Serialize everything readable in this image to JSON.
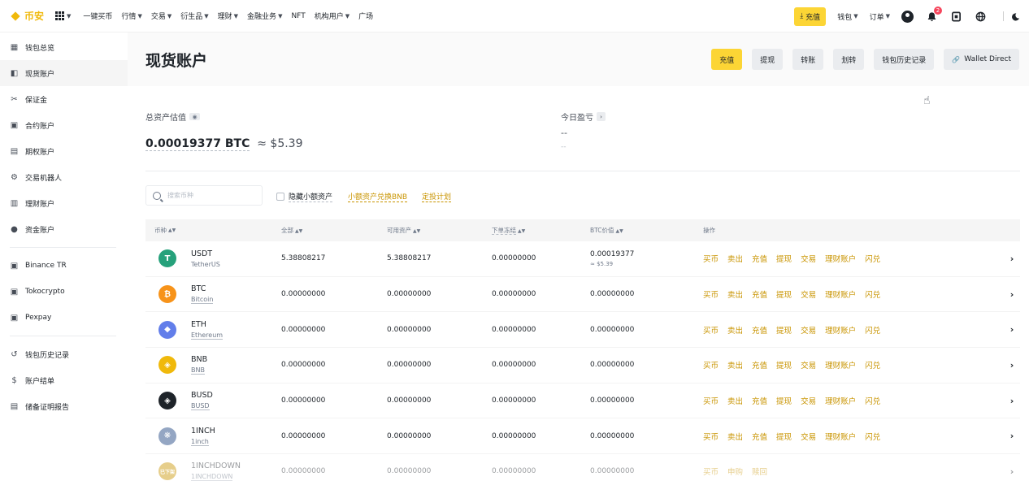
{
  "topbar": {
    "logo": "币安",
    "nav": [
      "一键买币",
      "行情",
      "交易",
      "衍生品",
      "理财",
      "金融业务",
      "NFT",
      "机构用户",
      "广场"
    ],
    "nav_dropdown": [
      false,
      true,
      true,
      true,
      true,
      true,
      false,
      true,
      false
    ],
    "deposit": "充值",
    "wallet": "钱包",
    "orders": "订单",
    "notif_count": "2"
  },
  "sidebar": {
    "items": [
      {
        "label": "钱包总览",
        "icon": "dashboard-icon"
      },
      {
        "label": "现货账户",
        "icon": "spot-icon",
        "active": true
      },
      {
        "label": "保证金",
        "icon": "margin-icon"
      },
      {
        "label": "合约账户",
        "icon": "futures-icon"
      },
      {
        "label": "期权账户",
        "icon": "options-icon"
      },
      {
        "label": "交易机器人",
        "icon": "bot-icon"
      },
      {
        "label": "理财账户",
        "icon": "earn-icon"
      },
      {
        "label": "资金账户",
        "icon": "funding-icon"
      }
    ],
    "external": [
      {
        "label": "Binance TR"
      },
      {
        "label": "Tokocrypto"
      },
      {
        "label": "Pexpay"
      }
    ],
    "bottom": [
      {
        "label": "钱包历史记录"
      },
      {
        "label": "账户结单"
      },
      {
        "label": "储备证明报告"
      }
    ]
  },
  "main": {
    "title": "现货账户",
    "actions": [
      "充值",
      "提现",
      "转账",
      "划转",
      "钱包历史记录",
      "Wallet Direct"
    ],
    "estimate_label": "总资产估值",
    "estimate_btc": "0.00019377 BTC",
    "estimate_fiat": "≈ $5.39",
    "pnl_label": "今日盈亏",
    "pnl_value": "--",
    "pnl_sub": "--",
    "search_placeholder": "搜索币种",
    "hide_small": "隐藏小额资产",
    "convert_bnb": "小额资产兑换BNB",
    "invest_plan": "定投计划"
  },
  "table": {
    "headers": {
      "coin": "币种",
      "total": "全部",
      "available": "可用资产",
      "in_order": "下单冻结",
      "btc_value": "BTC价值",
      "ops": "操作"
    },
    "rows": [
      {
        "sym": "USDT",
        "name": "TetherUS",
        "total": "5.38808217",
        "available": "5.38808217",
        "in_order": "0.00000000",
        "btc": "0.00019377",
        "btc_sub": "≈ $5.39",
        "color": "#26a17b",
        "glyph": "T",
        "ops": [
          "买币",
          "卖出",
          "充值",
          "提现",
          "交易",
          "理财账户",
          "闪兑"
        ]
      },
      {
        "sym": "BTC",
        "name": "Bitcoin",
        "total": "0.00000000",
        "available": "0.00000000",
        "in_order": "0.00000000",
        "btc": "0.00000000",
        "color": "#f7931a",
        "glyph": "₿",
        "ops": [
          "买币",
          "卖出",
          "充值",
          "提现",
          "交易",
          "理财账户",
          "闪兑"
        ]
      },
      {
        "sym": "ETH",
        "name": "Ethereum",
        "total": "0.00000000",
        "available": "0.00000000",
        "in_order": "0.00000000",
        "btc": "0.00000000",
        "color": "#627eea",
        "glyph": "◆",
        "ops": [
          "买币",
          "卖出",
          "充值",
          "提现",
          "交易",
          "理财账户",
          "闪兑"
        ]
      },
      {
        "sym": "BNB",
        "name": "BNB",
        "total": "0.00000000",
        "available": "0.00000000",
        "in_order": "0.00000000",
        "btc": "0.00000000",
        "color": "#f0b90b",
        "glyph": "◈",
        "ops": [
          "买币",
          "卖出",
          "充值",
          "提现",
          "交易",
          "理财账户",
          "闪兑"
        ]
      },
      {
        "sym": "BUSD",
        "name": "BUSD",
        "total": "0.00000000",
        "available": "0.00000000",
        "in_order": "0.00000000",
        "btc": "0.00000000",
        "color": "#1e2329",
        "glyph": "◈",
        "ops": [
          "买币",
          "卖出",
          "充值",
          "提现",
          "交易",
          "理财账户",
          "闪兑"
        ]
      },
      {
        "sym": "1INCH",
        "name": "1inch",
        "total": "0.00000000",
        "available": "0.00000000",
        "in_order": "0.00000000",
        "btc": "0.00000000",
        "color": "#94a6c3",
        "glyph": "❋",
        "ops": [
          "买币",
          "卖出",
          "充值",
          "提现",
          "交易",
          "理财账户",
          "闪兑"
        ]
      },
      {
        "sym": "1INCHDOWN",
        "name": "1INCHDOWN",
        "total": "0.00000000",
        "available": "0.00000000",
        "in_order": "0.00000000",
        "btc": "0.00000000",
        "color": "#c99400",
        "glyph": "已下架",
        "ops": [
          "买币",
          "申购",
          "赎回"
        ],
        "faded": true
      }
    ]
  }
}
